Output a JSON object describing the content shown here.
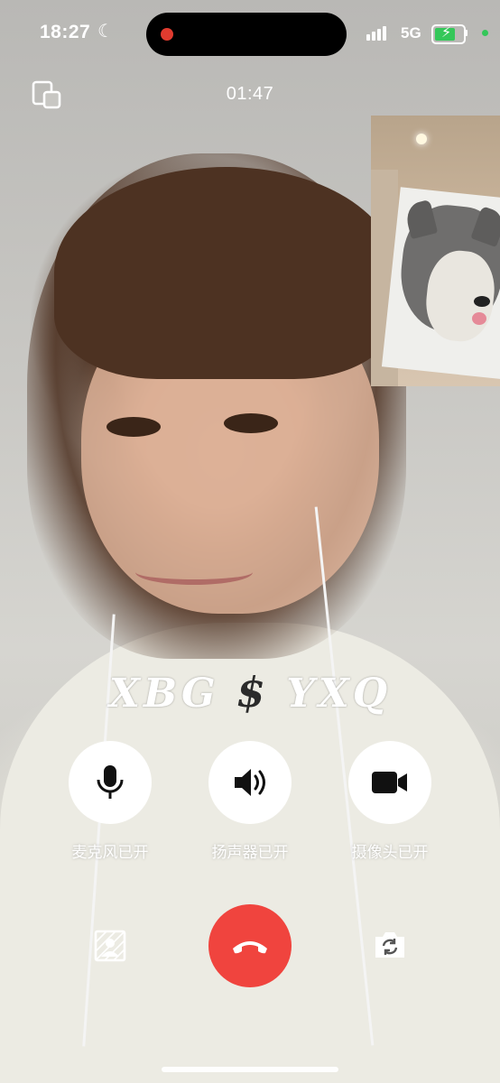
{
  "status_bar": {
    "time": "18:27",
    "network": "5G",
    "colors": {
      "battery": "#34c759",
      "recording": "#e03b2f",
      "privacy_dot": "#34c759"
    }
  },
  "call": {
    "duration": "01:47"
  },
  "watermark": {
    "left": "XBG",
    "symbol": "$",
    "right": "YXQ"
  },
  "controls": [
    {
      "label": "麦克风已开",
      "icon": "microphone-icon"
    },
    {
      "label": "扬声器已开",
      "icon": "speaker-icon"
    },
    {
      "label": "摄像头已开",
      "icon": "camera-icon"
    }
  ],
  "bottom_bar": {
    "left_icon": "background-blur-icon",
    "center_icon": "hang-up-icon",
    "right_icon": "switch-camera-icon",
    "colors": {
      "hangup": "#f0443e"
    }
  }
}
